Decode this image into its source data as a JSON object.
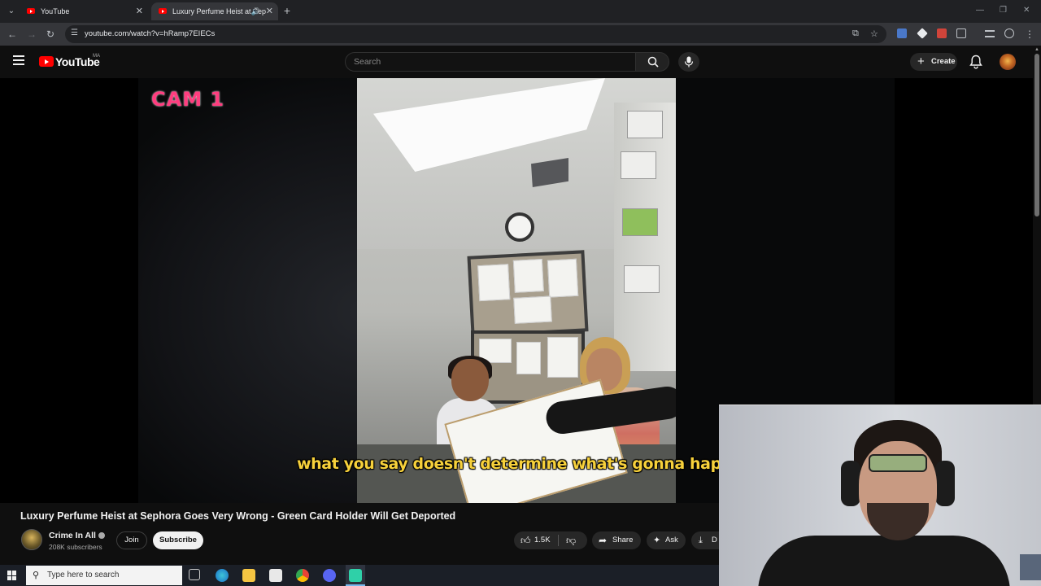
{
  "browser": {
    "tabs": [
      {
        "title": "YouTube"
      },
      {
        "title": "Luxury Perfume Heist at Sep"
      }
    ],
    "url": "youtube.com/watch?v=hRamp7EIECs"
  },
  "youtube": {
    "logo_text": "YouTube",
    "country_code": "MA",
    "search_placeholder": "Search",
    "create_label": "Create"
  },
  "player": {
    "cam_label": "CAM 1",
    "subtitle": "what you say doesn't determine what's gonna happe"
  },
  "video": {
    "title": "Luxury Perfume Heist at Sephora Goes Very Wrong - Green Card Holder Will Get Deported",
    "channel": "Crime In All",
    "subscribers": "208K subscribers",
    "join_label": "Join",
    "subscribe_label": "Subscribe",
    "likes": "1.5K",
    "share_label": "Share",
    "ask_label": "Ask",
    "download_label": "D"
  },
  "taskbar": {
    "search_placeholder": "Type here to search"
  },
  "colors": {
    "yt_red": "#ff0000",
    "cam_label": "#ff3d7f",
    "subtitle": "#f7d13b",
    "page_bg": "#0f0f0f"
  }
}
